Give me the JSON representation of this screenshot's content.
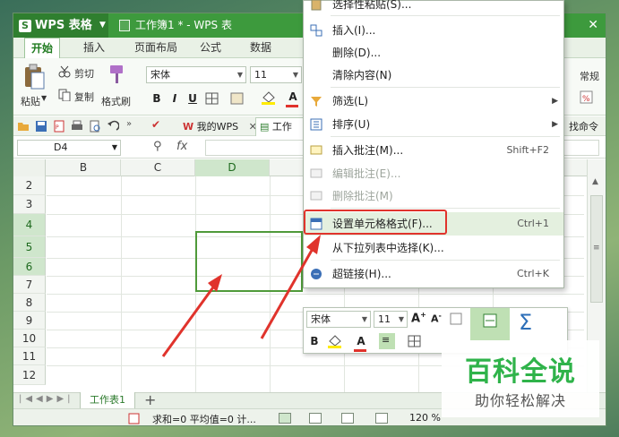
{
  "app": {
    "logo": "WPS 表格",
    "doc_title": "工作簿1 * - WPS 表",
    "close": "✕"
  },
  "ribbon_tabs": [
    "开始",
    "插入",
    "页面布局",
    "公式",
    "数据"
  ],
  "ribbon": {
    "paste": "粘贴",
    "cut": "剪切",
    "copy": "复制",
    "format_painter": "格式刷",
    "font": "宋体",
    "size": "11",
    "bold": "B",
    "italic": "I",
    "underline": "U",
    "color_a": "A",
    "normal": "常规"
  },
  "quickbar": {
    "my_wps": "我的WPS",
    "tab_close": "✕",
    "workbook_tab": "工作",
    "find_cmd": "找命令"
  },
  "formula_bar": {
    "cell_ref": "D4",
    "fx": "fx"
  },
  "grid": {
    "columns": [
      "B",
      "C",
      "D"
    ],
    "rows": [
      "2",
      "3",
      "4",
      "5",
      "6",
      "7",
      "8",
      "9",
      "10",
      "11",
      "12"
    ],
    "selected_column": "D",
    "selected_rows": [
      "4",
      "5",
      "6"
    ]
  },
  "sheets": {
    "active": "工作表1",
    "add": "+"
  },
  "status": {
    "summary": "求和=0  平均值=0  计...",
    "zoom": "120 %"
  },
  "context_menu": {
    "items": [
      {
        "label": "选择性粘贴(S)...",
        "shortcut": "",
        "disabled": false
      },
      {
        "label": "插入(I)...",
        "shortcut": "",
        "disabled": false
      },
      {
        "label": "删除(D)...",
        "shortcut": "",
        "disabled": false
      },
      {
        "label": "清除内容(N)",
        "shortcut": "",
        "disabled": false
      },
      {
        "label": "筛选(L)",
        "shortcut": "",
        "disabled": false,
        "submenu": true
      },
      {
        "label": "排序(U)",
        "shortcut": "",
        "disabled": false,
        "submenu": true
      },
      {
        "label": "插入批注(M)...",
        "shortcut": "Shift+F2",
        "disabled": false
      },
      {
        "label": "编辑批注(E)...",
        "shortcut": "",
        "disabled": true
      },
      {
        "label": "删除批注(M)",
        "shortcut": "",
        "disabled": true
      },
      {
        "label": "设置单元格格式(F)...",
        "shortcut": "Ctrl+1",
        "disabled": false,
        "highlighted": true
      },
      {
        "label": "从下拉列表中选择(K)...",
        "shortcut": "",
        "disabled": false
      },
      {
        "label": "超链接(H)...",
        "shortcut": "Ctrl+K",
        "disabled": false
      }
    ]
  },
  "mini_toolbar": {
    "font": "宋体",
    "size": "11",
    "bold": "B",
    "color_a": "A",
    "sum_icon": "Σ"
  },
  "watermark": {
    "title": "百科全说",
    "subtitle": "助你轻松解决"
  },
  "colors": {
    "accent_green": "#3d9a3d",
    "selection_green": "#4f9a3a",
    "annotation_red": "#e0332c",
    "watermark_green": "#2fb34a"
  }
}
